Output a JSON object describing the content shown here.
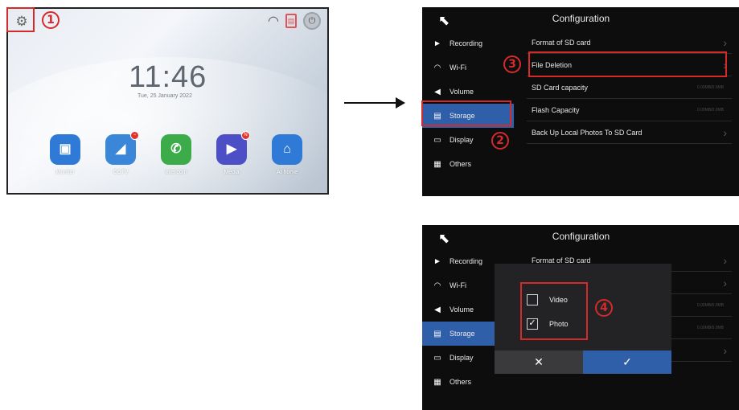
{
  "home": {
    "time": "11:46",
    "date": "Tue, 25 January 2022",
    "gear_icon": "gear-icon",
    "apps": [
      {
        "label": "Monitor",
        "icon": "monitor-icon",
        "color": "#2f7ad6",
        "glyph": "▣"
      },
      {
        "label": "CCTV",
        "icon": "camera-icon",
        "color": "#3a86d8",
        "glyph": "◢"
      },
      {
        "label": "Intercom",
        "icon": "phone-icon",
        "color": "#3cab49",
        "glyph": "✆"
      },
      {
        "label": "Media",
        "icon": "play-icon",
        "color": "#4c4fc6",
        "glyph": "▶"
      },
      {
        "label": "At home",
        "icon": "home-icon",
        "color": "#2f7ad6",
        "glyph": "⌂"
      }
    ],
    "badges": {
      "cctv": "−",
      "media": "N"
    }
  },
  "markers": {
    "one": "1",
    "two": "2",
    "three": "3",
    "four": "4"
  },
  "config": {
    "title": "Configuration",
    "back_glyph": "⬉",
    "sidebar": [
      {
        "label": "Recording",
        "icon": "recording-icon",
        "glyph": "►"
      },
      {
        "label": "Wi-Fi",
        "icon": "wifi-icon",
        "glyph": "◠"
      },
      {
        "label": "Volume",
        "icon": "volume-icon",
        "glyph": "◀"
      },
      {
        "label": "Storage",
        "icon": "storage-icon",
        "glyph": "▤"
      },
      {
        "label": "Display",
        "icon": "display-icon",
        "glyph": "▭"
      },
      {
        "label": "Others",
        "icon": "others-icon",
        "glyph": "▦"
      }
    ],
    "rows": [
      {
        "label": "Format of SD card",
        "type": "link"
      },
      {
        "label": "File Deletion",
        "type": "link"
      },
      {
        "label": "SD Card capacity",
        "type": "value",
        "value": "0.00MB/0.0MB"
      },
      {
        "label": "Flash Capacity",
        "type": "value",
        "value": "0.00MB/0.0MB"
      },
      {
        "label": "Back Up Local Photos To SD Card",
        "type": "link"
      }
    ]
  },
  "dialog": {
    "options": [
      {
        "label": "Video",
        "checked": false
      },
      {
        "label": "Photo",
        "checked": true
      }
    ],
    "cancel_glyph": "✕",
    "ok_glyph": "✓",
    "check_glyph": "✓"
  },
  "colors": {
    "accent": "#2f5fa8",
    "highlight": "#d42a2a"
  }
}
